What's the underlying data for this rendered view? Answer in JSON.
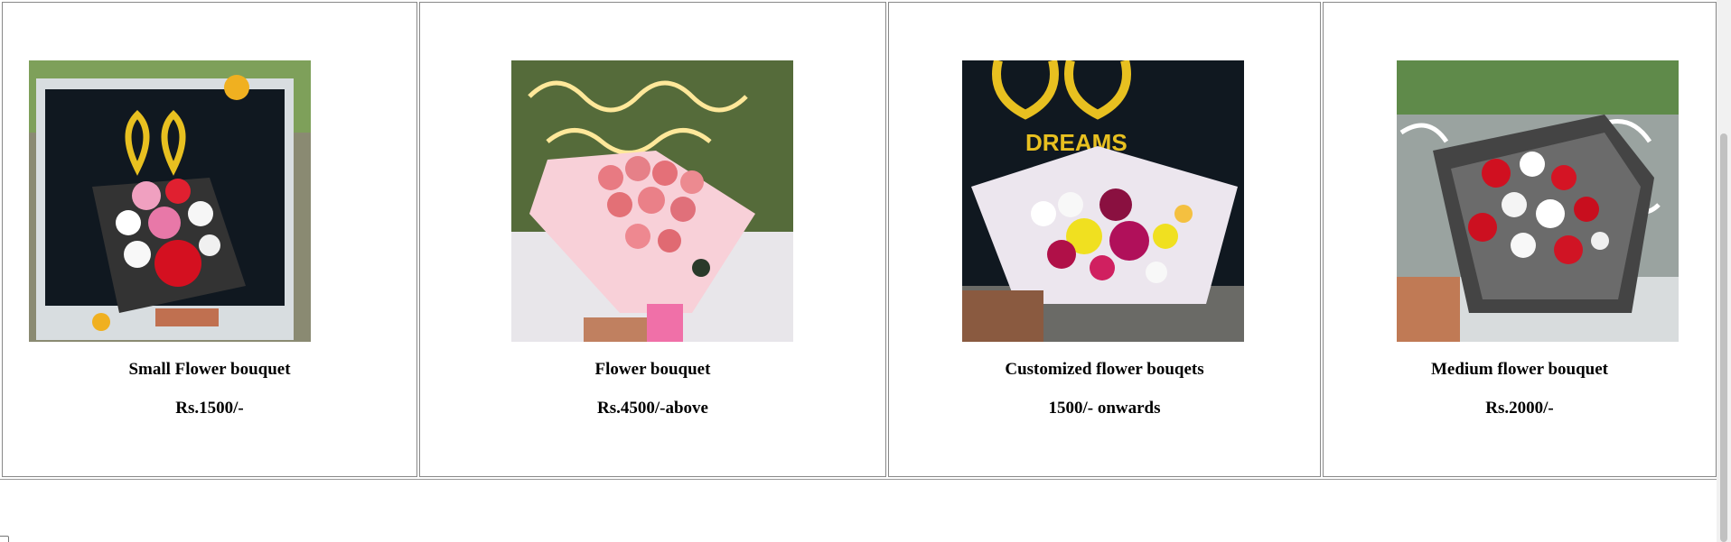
{
  "products": [
    {
      "name": "Small Flower bouquet",
      "price": "Rs.1500/-",
      "image_subject": "small-bouquet-photo"
    },
    {
      "name": "Flower bouquet",
      "price": "Rs.4500/-above",
      "image_subject": "pink-rose-bouquet-photo"
    },
    {
      "name": "Customized flower bouqets",
      "price": "1500/- onwards",
      "image_subject": "customized-bouquet-photo"
    },
    {
      "name": "Medium flower bouquet",
      "price": "Rs.2000/-",
      "image_subject": "medium-bouquet-photo"
    }
  ]
}
